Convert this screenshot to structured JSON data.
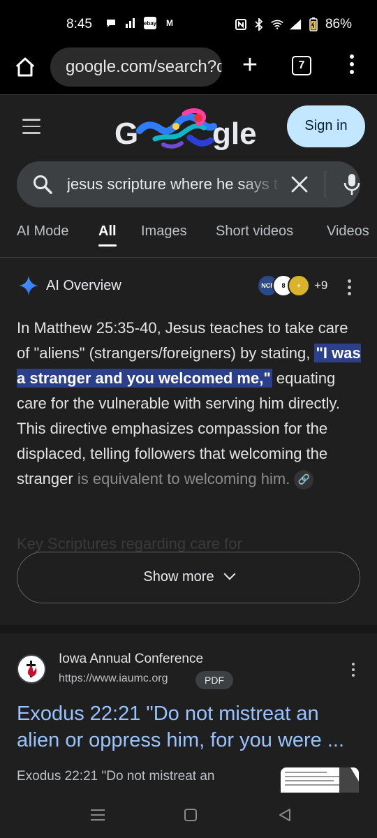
{
  "status_bar": {
    "time": "8:45",
    "battery": "86%",
    "left_icons": [
      "chat-bubble-icon",
      "signal-bars-icon",
      "ebay-icon",
      "gmail-icon"
    ],
    "ebay_label": "ebay",
    "gmail_label": "M",
    "right_icons": [
      "nfc-icon",
      "bluetooth-icon",
      "wifi-icon",
      "cell-signal-icon",
      "battery-icon"
    ]
  },
  "browser": {
    "url": "google.com/search?q=jesus",
    "tab_count": "7",
    "new_tab_label": "+"
  },
  "google_header": {
    "logo_text_left": "G",
    "logo_text_right": "gle",
    "signin_label": "Sign in"
  },
  "search": {
    "query": "jesus scripture where he says to take care of aliens"
  },
  "tabs": [
    {
      "label": "AI Mode",
      "active": false
    },
    {
      "label": "All",
      "active": true
    },
    {
      "label": "Images",
      "active": false
    },
    {
      "label": "Short videos",
      "active": false
    },
    {
      "label": "Videos",
      "active": false
    }
  ],
  "ai_overview": {
    "title": "AI Overview",
    "source_favicons": [
      "NCR",
      "8",
      "+"
    ],
    "extra_sources": "+9",
    "body_part1": "In Matthew 25:35-40, Jesus teaches to take care of \"aliens\" (strangers/foreigners) by stating, ",
    "body_highlight": "\"I was a stranger and you welcomed me,\"",
    "body_part2": " equating care for the vulnerable with serving him directly. This directive emphasizes compassion for the displaced, telling followers that welcoming the stranger ",
    "body_faded": "is equivalent to welcoming him.",
    "ghost_text": "Key Scriptures regarding care for",
    "show_more_label": "Show more"
  },
  "result": {
    "site_name": "Iowa Annual Conference",
    "url": "https://www.iaumc.org",
    "badge": "PDF",
    "title": "Exodus 22:21 \"Do not mistreat an alien or oppress him, for you were ...",
    "snippet": "Exodus 22:21 \"Do not mistreat an"
  },
  "colors": {
    "background": "#1f1f1f",
    "signin_bg": "#c2e7ff",
    "link": "#99c3ff",
    "highlight": "#2b3f8a"
  }
}
